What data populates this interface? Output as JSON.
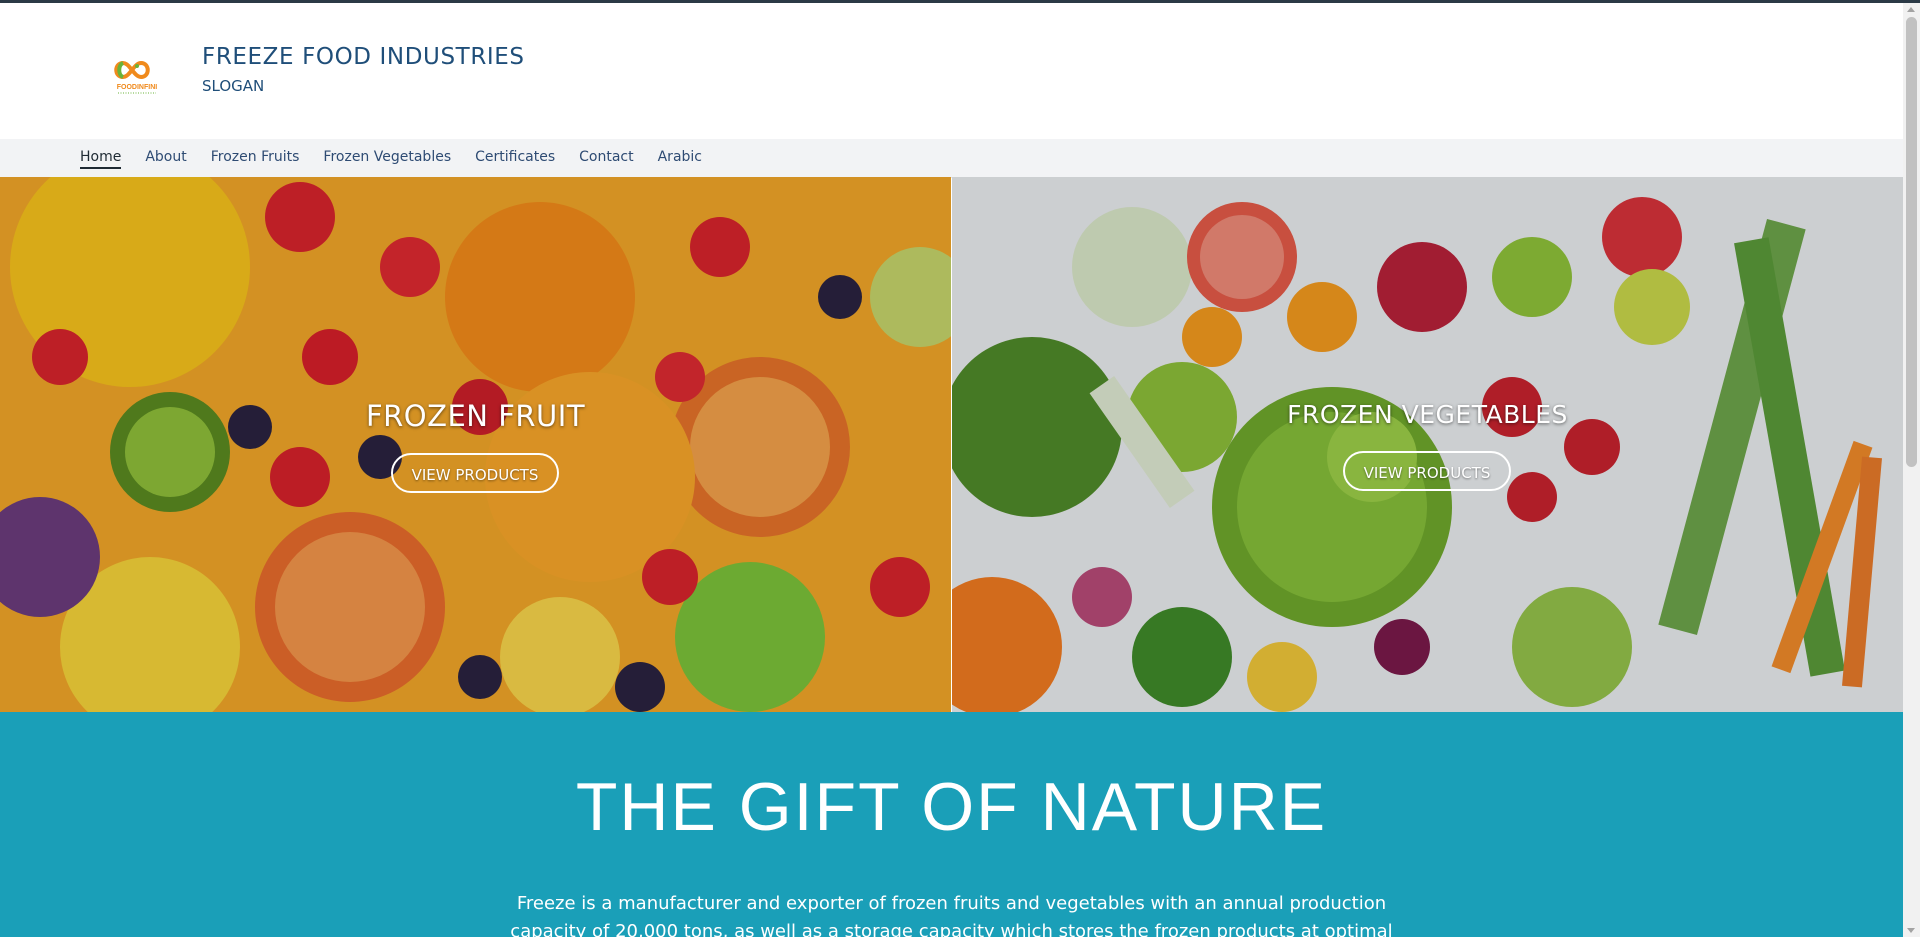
{
  "header": {
    "title": "FREEZE FOOD INDUSTRIES",
    "slogan": "SLOGAN",
    "logo_text": "FOODINFINI"
  },
  "nav": {
    "items": [
      {
        "label": "Home",
        "active": true
      },
      {
        "label": "About"
      },
      {
        "label": "Frozen Fruits"
      },
      {
        "label": "Frozen Vegetables"
      },
      {
        "label": "Certificates"
      },
      {
        "label": "Contact"
      },
      {
        "label": "Arabic"
      }
    ]
  },
  "hero": {
    "fruit": {
      "heading": "FROZEN FRUIT",
      "button": "VIEW PRODUCTS"
    },
    "vegetables": {
      "heading": "FROZEN VEGETABLES",
      "button": "VIEW PRODUCTS"
    }
  },
  "gift": {
    "title": "THE GIFT OF NATURE",
    "text": "Freeze is a manufacturer and exporter of frozen fruits and vegetables with an annual production capacity of 20,000 tons, as well as a storage capacity which stores the frozen products at optimal temperatures until it"
  },
  "colors": {
    "brand_text": "#1f4e79",
    "nav_bg": "#f2f3f5",
    "band": "#1a9fb8"
  }
}
